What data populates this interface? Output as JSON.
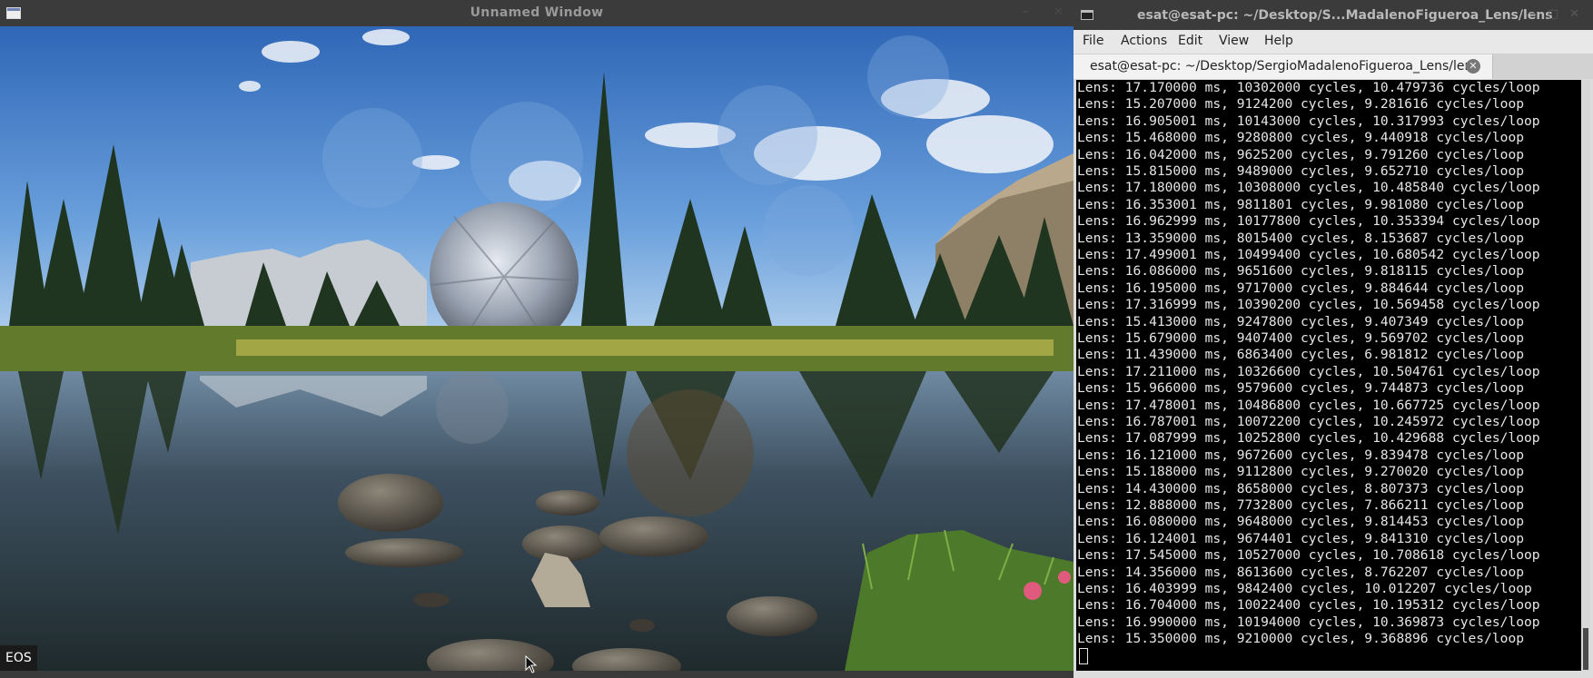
{
  "image_window": {
    "title": "Unnamed Window",
    "status_text": "EOS",
    "image_description_icon": "landscape-image"
  },
  "terminal": {
    "title": "esat@esat-pc: ~/Desktop/S...MadalenoFigueroa_Lens/lens",
    "menu": [
      "File",
      "Actions",
      "Edit",
      "View",
      "Help"
    ],
    "tab_label": "esat@esat-pc: ~/Desktop/SergioMadalenoFigueroa_Lens/lens",
    "lines": [
      "Lens: 17.170000 ms, 10302000 cycles, 10.479736 cycles/loop",
      "Lens: 15.207000 ms, 9124200 cycles, 9.281616 cycles/loop",
      "Lens: 16.905001 ms, 10143000 cycles, 10.317993 cycles/loop",
      "Lens: 15.468000 ms, 9280800 cycles, 9.440918 cycles/loop",
      "Lens: 16.042000 ms, 9625200 cycles, 9.791260 cycles/loop",
      "Lens: 15.815000 ms, 9489000 cycles, 9.652710 cycles/loop",
      "Lens: 17.180000 ms, 10308000 cycles, 10.485840 cycles/loop",
      "Lens: 16.353001 ms, 9811801 cycles, 9.981080 cycles/loop",
      "Lens: 16.962999 ms, 10177800 cycles, 10.353394 cycles/loop",
      "Lens: 13.359000 ms, 8015400 cycles, 8.153687 cycles/loop",
      "Lens: 17.499001 ms, 10499400 cycles, 10.680542 cycles/loop",
      "Lens: 16.086000 ms, 9651600 cycles, 9.818115 cycles/loop",
      "Lens: 16.195000 ms, 9717000 cycles, 9.884644 cycles/loop",
      "Lens: 17.316999 ms, 10390200 cycles, 10.569458 cycles/loop",
      "Lens: 15.413000 ms, 9247800 cycles, 9.407349 cycles/loop",
      "Lens: 15.679000 ms, 9407400 cycles, 9.569702 cycles/loop",
      "Lens: 11.439000 ms, 6863400 cycles, 6.981812 cycles/loop",
      "Lens: 17.211000 ms, 10326600 cycles, 10.504761 cycles/loop",
      "Lens: 15.966000 ms, 9579600 cycles, 9.744873 cycles/loop",
      "Lens: 17.478001 ms, 10486800 cycles, 10.667725 cycles/loop",
      "Lens: 16.787001 ms, 10072200 cycles, 10.245972 cycles/loop",
      "Lens: 17.087999 ms, 10252800 cycles, 10.429688 cycles/loop",
      "Lens: 16.121000 ms, 9672600 cycles, 9.839478 cycles/loop",
      "Lens: 15.188000 ms, 9112800 cycles, 9.270020 cycles/loop",
      "Lens: 14.430000 ms, 8658000 cycles, 8.807373 cycles/loop",
      "Lens: 12.888000 ms, 7732800 cycles, 7.866211 cycles/loop",
      "Lens: 16.080000 ms, 9648000 cycles, 9.814453 cycles/loop",
      "Lens: 16.124001 ms, 9674401 cycles, 9.841310 cycles/loop",
      "Lens: 17.545000 ms, 10527000 cycles, 10.708618 cycles/loop",
      "Lens: 14.356000 ms, 8613600 cycles, 8.762207 cycles/loop",
      "Lens: 16.403999 ms, 9842400 cycles, 10.012207 cycles/loop",
      "Lens: 16.704000 ms, 10022400 cycles, 10.195312 cycles/loop",
      "Lens: 16.990000 ms, 10194000 cycles, 10.369873 cycles/loop",
      "Lens: 15.350000 ms, 9210000 cycles, 9.368896 cycles/loop"
    ]
  },
  "colors": {
    "titlebar_bg": "#3b3b3b",
    "terminal_bg": "#000000",
    "terminal_fg": "#e6e6e6",
    "tab_close_bg": "#777777"
  }
}
